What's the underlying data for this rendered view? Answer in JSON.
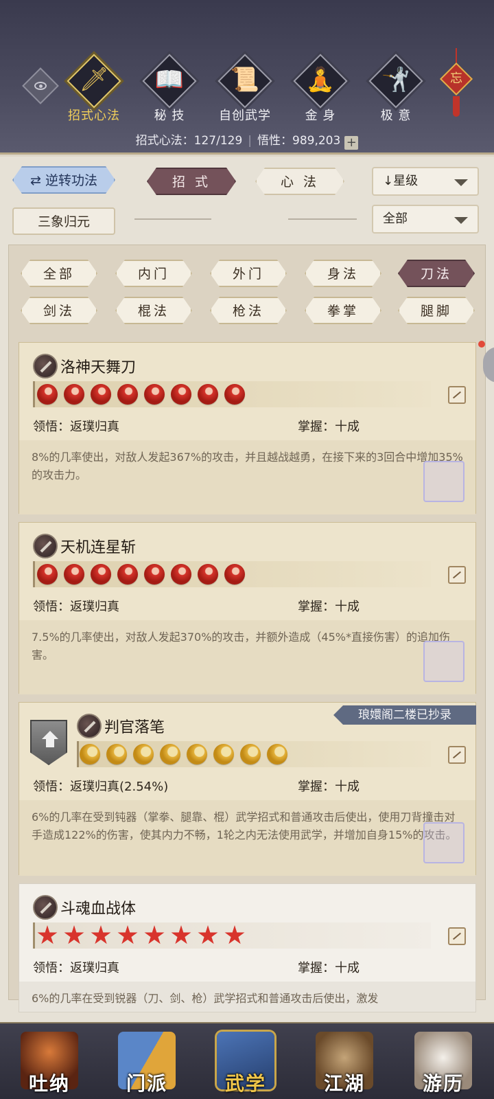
{
  "header": {
    "tabs": [
      {
        "label": "招式心法",
        "icon": "sword-icon",
        "glyph": "🗡"
      },
      {
        "label": "秘 技",
        "icon": "book-icon",
        "glyph": "📖"
      },
      {
        "label": "自创武学",
        "icon": "scroll-icon",
        "glyph": "📜"
      },
      {
        "label": "金 身",
        "icon": "meditation-icon",
        "glyph": "🧘"
      },
      {
        "label": "极 意",
        "icon": "martial-stance-icon",
        "glyph": "🤺"
      }
    ],
    "charm_text": "忘",
    "stats": {
      "skills_label": "招式心法：",
      "skills_value": "127/129",
      "insight_label": "悟性：",
      "insight_value": "989,203",
      "plus": "+"
    }
  },
  "filters": {
    "reverse_button": "逆转功法",
    "reverse_icon": "⇄",
    "tab_moves": "招 式",
    "tab_mind": "心 法",
    "sort_dropdown": "↓星级",
    "sanxiang_button": "三象归元",
    "scope_dropdown": "全部"
  },
  "categories": [
    "全部",
    "内门",
    "外门",
    "身法",
    "刀法",
    "剑法",
    "棍法",
    "枪法",
    "拳掌",
    "腿脚"
  ],
  "active_category": "刀法",
  "skills": [
    {
      "name": "洛神天舞刀",
      "rating_type": "flame",
      "rating_count": 8,
      "comprehension_label": "领悟：",
      "comprehension_value": "返璞归真",
      "mastery_label": "掌握：",
      "mastery_value": "十成",
      "description": "8%的几率使出，对敌人发起367%的攻击，并且越战越勇，在接下来的3回合中增加35%的攻击力。"
    },
    {
      "name": "天机连星斩",
      "rating_type": "flame",
      "rating_count": 8,
      "comprehension_label": "领悟：",
      "comprehension_value": "返璞归真",
      "mastery_label": "掌握：",
      "mastery_value": "十成",
      "description": "7.5%的几率使出，对敌人发起370%的攻击，并额外造成（45%*直接伤害）的追加伤害。"
    },
    {
      "name": "判官落笔",
      "rating_type": "moon",
      "rating_count": 8,
      "banner": "琅嬛阁二楼已抄录",
      "comprehension_label": "领悟：",
      "comprehension_value": "返璞归真(2.54%)",
      "mastery_label": "掌握：",
      "mastery_value": "十成",
      "description": "6%的几率在受到钝器（掌拳、腿靠、棍）武学招式和普通攻击后使出，使用刀背撞击对手造成122%的伤害，使其内力不畅，1轮之内无法使用武学，并增加自身15%的攻击。"
    },
    {
      "name": "斗魂血战体",
      "rating_type": "star",
      "rating_count": 8,
      "comprehension_label": "领悟：",
      "comprehension_value": "返璞归真",
      "mastery_label": "掌握：",
      "mastery_value": "十成",
      "description": "6%的几率在受到锐器（刀、剑、枪）武学招式和普通攻击后使出，激发"
    }
  ],
  "bottom_nav": [
    {
      "label": "吐纳",
      "icon": "monk-icon",
      "color": "#8a3a22"
    },
    {
      "label": "门派",
      "icon": "sect-banners-icon",
      "color": "#4a6fb0"
    },
    {
      "label": "武学",
      "icon": "manuals-icon",
      "color": "#3b5e9a"
    },
    {
      "label": "江湖",
      "icon": "straw-hat-icon",
      "color": "#7a5a3a"
    },
    {
      "label": "游历",
      "icon": "white-horse-icon",
      "color": "#b8b0a8"
    }
  ],
  "active_bottom": "武学"
}
